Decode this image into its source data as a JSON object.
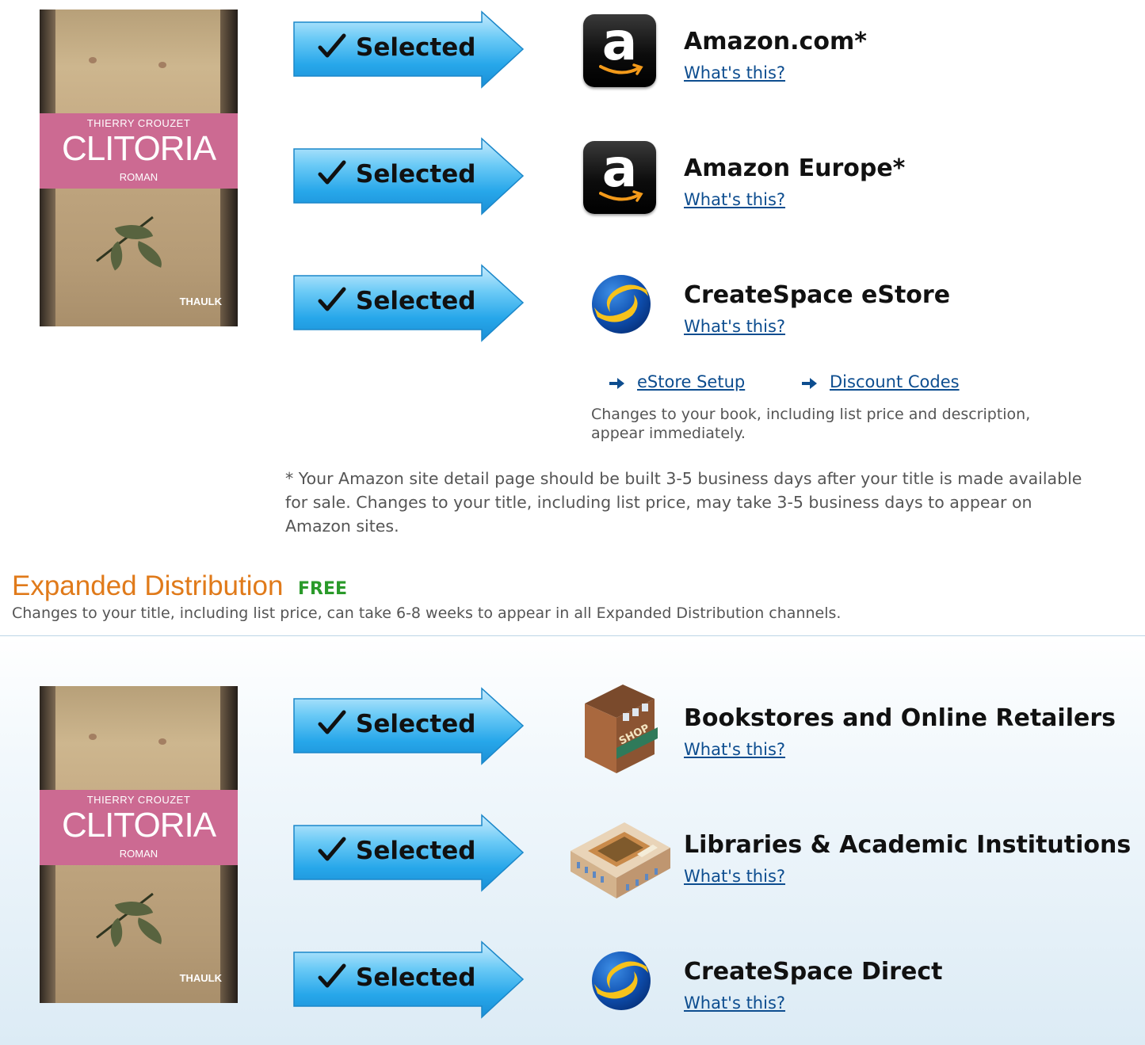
{
  "book": {
    "author": "THIERRY CROUZET",
    "title": "CLITORIA",
    "subtitle": "ROMAN",
    "publisher": "THAULK"
  },
  "standard_channels": [
    {
      "status": "Selected",
      "name": "Amazon.com*",
      "link": "What's this?",
      "icon": "amazon-icon"
    },
    {
      "status": "Selected",
      "name": "Amazon Europe*",
      "link": "What's this?",
      "icon": "amazon-icon"
    },
    {
      "status": "Selected",
      "name": "CreateSpace eStore",
      "link": "What's this?",
      "icon": "createspace-globe-icon"
    }
  ],
  "estore_links": {
    "setup": "eStore Setup",
    "discount": "Discount Codes"
  },
  "estore_note": "Changes to your book, including list price and description, appear immediately.",
  "amazon_note": "* Your Amazon site detail page should be built 3-5 business days after your title is made available for sale. Changes to your title, including list price, may take 3-5 business days to appear on Amazon sites.",
  "expanded": {
    "title": "Expanded Distribution",
    "badge": "FREE",
    "subtitle": "Changes to your title, including list price, can take 6-8 weeks to appear in all Expanded Distribution channels."
  },
  "expanded_channels": [
    {
      "status": "Selected",
      "name": "Bookstores and Online Retailers",
      "link": "What's this?",
      "icon": "bookstore-shop-icon"
    },
    {
      "status": "Selected",
      "name": "Libraries & Academic Institutions",
      "link": "What's this?",
      "icon": "library-building-icon"
    },
    {
      "status": "Selected",
      "name": "CreateSpace Direct",
      "link": "What's this?",
      "icon": "createspace-globe-icon"
    }
  ],
  "colors": {
    "orange_heading": "#e07a1a",
    "free_green": "#2a9a2a",
    "link_blue": "#0d4d8f",
    "arrow_blue": "#3bb0ea"
  }
}
